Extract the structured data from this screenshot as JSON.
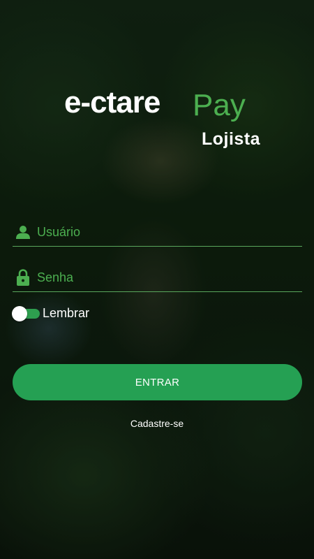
{
  "brand": {
    "logo_main": "e-ctare",
    "logo_pay": "Pay",
    "subtitle": "Lojista"
  },
  "form": {
    "username_placeholder": "Usuário",
    "username_value": "",
    "password_placeholder": "Senha",
    "password_value": "",
    "remember_label": "Lembrar",
    "remember_on": true
  },
  "actions": {
    "enter_label": "ENTRAR",
    "signup_label": "Cadastre-se"
  },
  "colors": {
    "accent": "#4caf50",
    "button": "#25a053",
    "text": "#ffffff"
  },
  "icons": {
    "username": "person-icon",
    "password": "lock-icon"
  }
}
